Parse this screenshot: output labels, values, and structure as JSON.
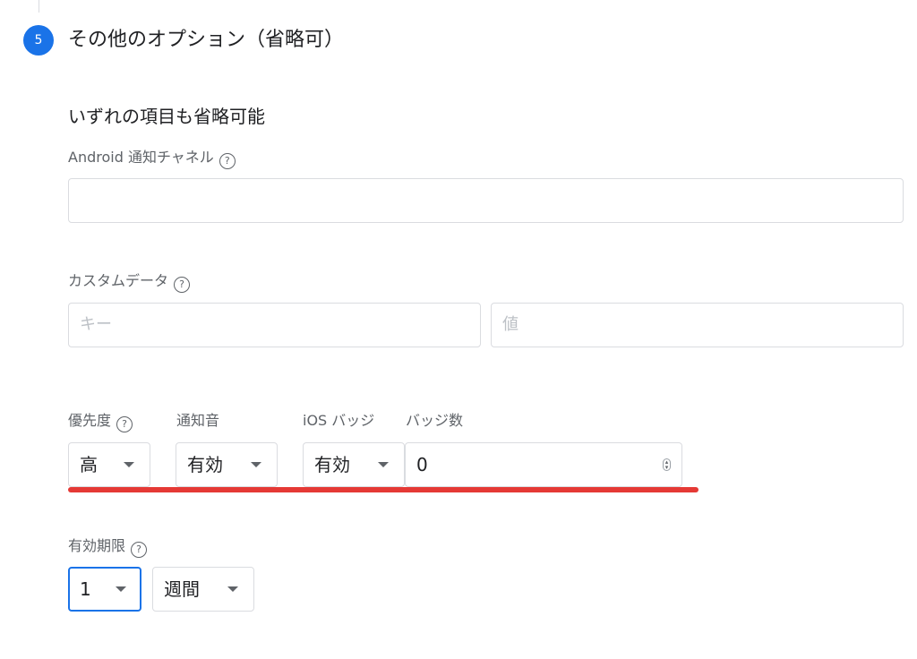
{
  "step": {
    "number": "5",
    "title": "その他のオプション（省略可）"
  },
  "section": {
    "title": "いずれの項目も省略可能"
  },
  "android_channel": {
    "label": "Android 通知チャネル",
    "value": ""
  },
  "custom_data": {
    "label": "カスタムデータ",
    "key_placeholder": "キー",
    "value_placeholder": "値"
  },
  "priority": {
    "label": "優先度",
    "value": "高"
  },
  "sound": {
    "label": "通知音",
    "value": "有効"
  },
  "ios_badge": {
    "label": "iOS バッジ",
    "value": "有効"
  },
  "badge_count": {
    "label": "バッジ数",
    "value": "0"
  },
  "expiration": {
    "label": "有効期限",
    "amount": "1",
    "unit": "週間"
  },
  "help_glyph": "?",
  "colors": {
    "accent": "#1a73e8",
    "annotation": "#e53935"
  }
}
